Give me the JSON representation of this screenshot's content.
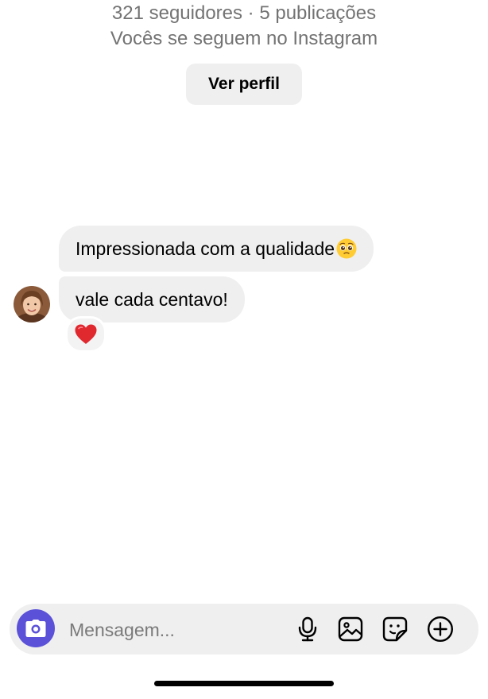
{
  "profile": {
    "stats": "321 seguidores · 5 publicações",
    "mutual": "Vocês se seguem no Instagram",
    "view_profile_label": "Ver perfil"
  },
  "messages": [
    {
      "text": "Impressionada com a qualidade",
      "emoji": "pleading-face"
    },
    {
      "text": "vale cada centavo!",
      "reaction": "red-heart"
    }
  ],
  "composer": {
    "placeholder": "Mensagem...",
    "icons": [
      "camera-icon",
      "microphone-icon",
      "gallery-icon",
      "sticker-icon",
      "plus-icon"
    ],
    "camera_color": "#5b51d8"
  },
  "colors": {
    "bubble": "#efefef",
    "meta_text": "#737373",
    "heart": "#e0282f"
  }
}
